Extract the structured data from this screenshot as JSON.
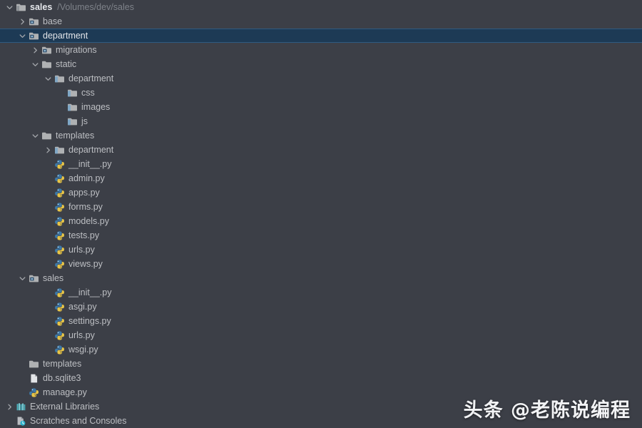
{
  "project": {
    "root_name": "sales",
    "root_path": "/Volumes/dev/sales"
  },
  "colors": {
    "background": "#3C3F47",
    "text": "#BDBFC3",
    "muted_text": "#7E8289",
    "selection_bg": "#1D3A55",
    "selection_border": "#2F5B80",
    "folder": "#AFB1B3",
    "package_folder": "#6E9FC4",
    "python_blue": "#3C78A8",
    "python_yellow": "#E8C547",
    "library_teal": "#4BB8C4",
    "file_white": "#E3E5E8"
  },
  "watermark": "头条 @老陈说编程",
  "tree": [
    {
      "label": "sales",
      "path": "/Volumes/dev/sales",
      "indent": 0,
      "icon": "module-folder-icon",
      "chevron": "expanded",
      "bold": true,
      "selected": false
    },
    {
      "label": "base",
      "indent": 1,
      "icon": "package-folder-icon",
      "chevron": "collapsed",
      "bold": false,
      "selected": false
    },
    {
      "label": "department",
      "indent": 1,
      "icon": "package-folder-icon",
      "chevron": "expanded",
      "bold": false,
      "selected": true
    },
    {
      "label": "migrations",
      "indent": 2,
      "icon": "package-folder-icon",
      "chevron": "collapsed",
      "bold": false,
      "selected": false
    },
    {
      "label": "static",
      "indent": 2,
      "icon": "folder-icon",
      "chevron": "expanded",
      "bold": false,
      "selected": false
    },
    {
      "label": "department",
      "indent": 3,
      "icon": "resource-folder-icon",
      "chevron": "expanded",
      "bold": false,
      "selected": false
    },
    {
      "label": "css",
      "indent": 4,
      "icon": "resource-folder-icon",
      "chevron": "none",
      "bold": false,
      "selected": false
    },
    {
      "label": "images",
      "indent": 4,
      "icon": "resource-folder-icon",
      "chevron": "none",
      "bold": false,
      "selected": false
    },
    {
      "label": "js",
      "indent": 4,
      "icon": "resource-folder-icon",
      "chevron": "none",
      "bold": false,
      "selected": false
    },
    {
      "label": "templates",
      "indent": 2,
      "icon": "folder-icon",
      "chevron": "expanded",
      "bold": false,
      "selected": false
    },
    {
      "label": "department",
      "indent": 3,
      "icon": "resource-folder-icon",
      "chevron": "collapsed",
      "bold": false,
      "selected": false
    },
    {
      "label": "__init__.py",
      "indent": 3,
      "icon": "python-file-icon",
      "chevron": "none",
      "bold": false,
      "selected": false
    },
    {
      "label": "admin.py",
      "indent": 3,
      "icon": "python-file-icon",
      "chevron": "none",
      "bold": false,
      "selected": false
    },
    {
      "label": "apps.py",
      "indent": 3,
      "icon": "python-file-icon",
      "chevron": "none",
      "bold": false,
      "selected": false
    },
    {
      "label": "forms.py",
      "indent": 3,
      "icon": "python-file-icon",
      "chevron": "none",
      "bold": false,
      "selected": false
    },
    {
      "label": "models.py",
      "indent": 3,
      "icon": "python-file-icon",
      "chevron": "none",
      "bold": false,
      "selected": false
    },
    {
      "label": "tests.py",
      "indent": 3,
      "icon": "python-file-icon",
      "chevron": "none",
      "bold": false,
      "selected": false
    },
    {
      "label": "urls.py",
      "indent": 3,
      "icon": "python-file-icon",
      "chevron": "none",
      "bold": false,
      "selected": false
    },
    {
      "label": "views.py",
      "indent": 3,
      "icon": "python-file-icon",
      "chevron": "none",
      "bold": false,
      "selected": false
    },
    {
      "label": "sales",
      "indent": 1,
      "icon": "package-folder-icon",
      "chevron": "expanded",
      "bold": false,
      "selected": false
    },
    {
      "label": "__init__.py",
      "indent": 3,
      "icon": "python-file-icon",
      "chevron": "none",
      "bold": false,
      "selected": false
    },
    {
      "label": "asgi.py",
      "indent": 3,
      "icon": "python-file-icon",
      "chevron": "none",
      "bold": false,
      "selected": false
    },
    {
      "label": "settings.py",
      "indent": 3,
      "icon": "python-file-icon",
      "chevron": "none",
      "bold": false,
      "selected": false
    },
    {
      "label": "urls.py",
      "indent": 3,
      "icon": "python-file-icon",
      "chevron": "none",
      "bold": false,
      "selected": false
    },
    {
      "label": "wsgi.py",
      "indent": 3,
      "icon": "python-file-icon",
      "chevron": "none",
      "bold": false,
      "selected": false
    },
    {
      "label": "templates",
      "indent": 1,
      "icon": "folder-icon",
      "chevron": "none",
      "bold": false,
      "selected": false
    },
    {
      "label": "db.sqlite3",
      "indent": 1,
      "icon": "file-icon",
      "chevron": "none",
      "bold": false,
      "selected": false
    },
    {
      "label": "manage.py",
      "indent": 1,
      "icon": "python-file-icon",
      "chevron": "none",
      "bold": false,
      "selected": false
    },
    {
      "label": "External Libraries",
      "indent": 0,
      "icon": "library-icon",
      "chevron": "collapsed",
      "bold": false,
      "selected": false
    },
    {
      "label": "Scratches and Consoles",
      "indent": 0,
      "icon": "scratches-icon",
      "chevron": "none",
      "bold": false,
      "selected": false
    }
  ]
}
